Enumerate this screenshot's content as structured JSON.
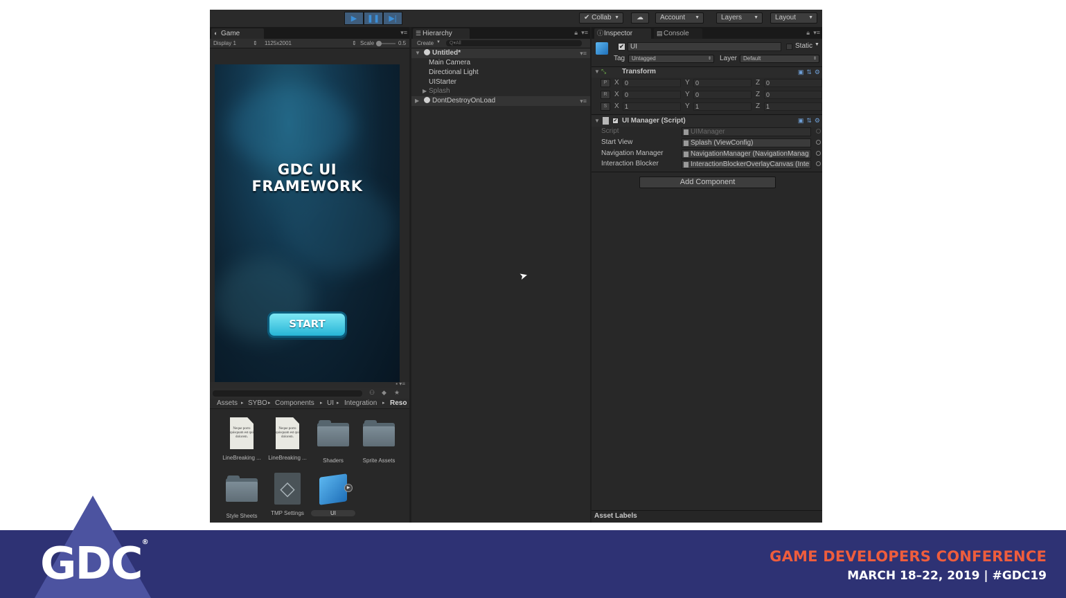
{
  "toolbar": {
    "collab": "Collab",
    "account": "Account",
    "layers": "Layers",
    "layout": "Layout"
  },
  "game": {
    "tab": "Game",
    "display": "Display 1",
    "resolution": "1125x2001",
    "scale_label": "Scale",
    "scale_value": "0.5",
    "title_line1": "GDC UI",
    "title_line2": "FRAMEWORK",
    "start": "START"
  },
  "hierarchy": {
    "tab": "Hierarchy",
    "create": "Create",
    "search_placeholder": "Q▾All",
    "scene": "Untitled*",
    "items": [
      "Main Camera",
      "Directional Light",
      "UIStarter",
      "Splash"
    ],
    "ddol": "DontDestroyOnLoad"
  },
  "inspector": {
    "tab": "Inspector",
    "console_tab": "Console",
    "object_name": "UI",
    "static": "Static",
    "tag_label": "Tag",
    "tag_value": "Untagged",
    "layer_label": "Layer",
    "layer_value": "Default",
    "transform": {
      "title": "Transform",
      "rows": [
        {
          "label": "P",
          "x": "0",
          "y": "0",
          "z": "0"
        },
        {
          "label": "R",
          "x": "0",
          "y": "0",
          "z": "0"
        },
        {
          "label": "S",
          "x": "1",
          "y": "1",
          "z": "1"
        }
      ]
    },
    "ui_manager": {
      "title": "UI Manager (Script)",
      "props": [
        {
          "label": "Script",
          "value": "UIManager"
        },
        {
          "label": "Start View",
          "value": "Splash (ViewConfig)"
        },
        {
          "label": "Navigation Manager",
          "value": "NavigationManager (NavigationManag"
        },
        {
          "label": "Interaction Blocker",
          "value": "InteractionBlockerOverlayCanvas (Inte"
        }
      ]
    },
    "add_component": "Add Component",
    "asset_labels": "Asset Labels"
  },
  "project": {
    "breadcrumb": [
      "Assets",
      "SYBO",
      "Components",
      "UI",
      "Integration",
      "Reso"
    ],
    "assets": [
      "LineBreaking ...",
      "LineBreaking ...",
      "Shaders",
      "Sprite Assets",
      "Style Sheets",
      "TMP Settings",
      "UI"
    ],
    "doc_text": "Neque porro quisquam est qui dolorem."
  },
  "footer": {
    "logo": "GDC",
    "conference": "GAME DEVELOPERS CONFERENCE",
    "dates": "MARCH 18–22, 2019  |  #GDC19"
  },
  "colors": {
    "footer_bg": "#2e3274",
    "accent_orange": "#ee5d3d",
    "play_blue": "#3b8fd8"
  }
}
